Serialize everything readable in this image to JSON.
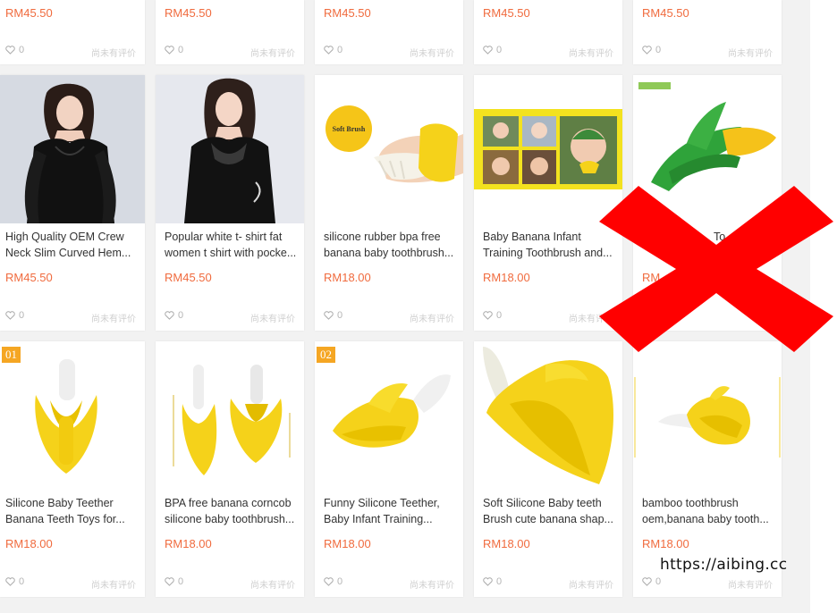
{
  "top_row": [
    {
      "price": "RM45.50",
      "likes": "0",
      "reviews": "尚未有评价"
    },
    {
      "price": "RM45.50",
      "likes": "0",
      "reviews": "尚未有评价"
    },
    {
      "price": "RM45.50",
      "likes": "0",
      "reviews": "尚未有评价"
    },
    {
      "price": "RM45.50",
      "likes": "0",
      "reviews": "尚未有评价"
    },
    {
      "price": "RM45.50",
      "likes": "0",
      "reviews": "尚未有评价"
    }
  ],
  "middle_row": [
    {
      "title_line1": "High Quality OEM Crew",
      "title_line2": "Neck Slim Curved Hem...",
      "price": "RM45.50",
      "likes": "0",
      "reviews": "尚未有评价",
      "image": "black-lace-blouse"
    },
    {
      "title_line1": "Popular white t- shirt fat",
      "title_line2": "women t shirt with pocke...",
      "price": "RM45.50",
      "likes": "0",
      "reviews": "尚未有评价",
      "image": "black-lace-top"
    },
    {
      "title_line1": "silicone rubber bpa free",
      "title_line2": "banana baby toothbrush...",
      "price": "RM18.00",
      "likes": "0",
      "reviews": "尚未有评价",
      "image": "banana-toothbrush-soft-brush",
      "image_label": "Soft Brush"
    },
    {
      "title_line1": "Baby Banana Infant",
      "title_line2": "Training Toothbrush and...",
      "price": "RM18.00",
      "likes": "0",
      "reviews": "尚未有评价",
      "image": "baby-photo-collage"
    },
    {
      "title_line1": "",
      "title_line2": "",
      "price": "",
      "likes": "0",
      "reviews": "尚未有评价",
      "image": "corn-teether",
      "partial_visible": "To",
      "price_partial": "RM"
    }
  ],
  "bottom_row": [
    {
      "badge": "01",
      "title_line1": "Silicone Baby Teether",
      "title_line2": "Banana Teeth Toys for...",
      "price": "RM18.00",
      "likes": "0",
      "reviews": "尚未有评价",
      "image": "banana-teether"
    },
    {
      "badge": "",
      "title_line1": "BPA free banana corncob",
      "title_line2": "silicone baby toothbrush...",
      "price": "RM18.00",
      "likes": "0",
      "reviews": "尚未有评价",
      "image": "two-banana-teethers"
    },
    {
      "badge": "02",
      "title_line1": "Funny Silicone Teether,",
      "title_line2": "Baby Infant Training...",
      "price": "RM18.00",
      "likes": "0",
      "reviews": "尚未有评价",
      "image": "banana-teether-side"
    },
    {
      "badge": "",
      "title_line1": "Soft Silicone Baby teeth",
      "title_line2": "Brush cute banana shap...",
      "price": "RM18.00",
      "likes": "0",
      "reviews": "尚未有评价",
      "image": "banana-teether-large"
    },
    {
      "badge": "",
      "title_line1": "bamboo toothbrush",
      "title_line2": "oem,banana baby tooth...",
      "price": "RM18.00",
      "likes": "0",
      "reviews": "尚未有评价",
      "image": "banana-teether-small"
    }
  ],
  "overlay": {
    "watermark": "https://aibing.cc",
    "mark": "red-x-icon"
  },
  "colors": {
    "price": "#f06b3e",
    "badge": "#f5a623",
    "x_mark": "#ff0000",
    "banana": "#f5d21a"
  }
}
